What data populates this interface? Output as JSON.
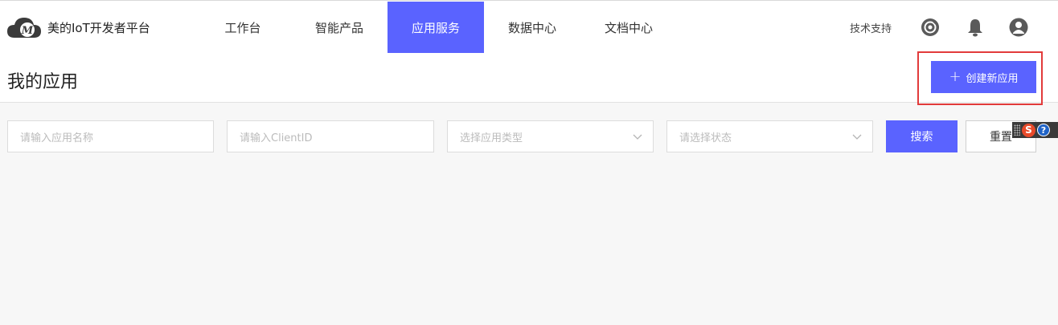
{
  "header": {
    "brand": "美的IoT开发者平台",
    "logo_letter": "M",
    "nav": [
      {
        "label": "工作台",
        "active": false
      },
      {
        "label": "智能产品",
        "active": false
      },
      {
        "label": "应用服务",
        "active": true
      },
      {
        "label": "数据中心",
        "active": false
      },
      {
        "label": "文档中心",
        "active": false
      }
    ],
    "tech_support": "技术支持",
    "icons": [
      "target-icon",
      "bell-icon",
      "user-avatar-icon"
    ]
  },
  "page": {
    "title": "我的应用",
    "create_button": "创建新应用"
  },
  "filters": {
    "app_name_placeholder": "请输入应用名称",
    "client_id_placeholder": "请输入ClientID",
    "app_type_placeholder": "选择应用类型",
    "status_placeholder": "请选择状态",
    "search_button": "搜索",
    "reset_button": "重置"
  },
  "ime_toolbar": {
    "logo_letter": "S",
    "help_symbol": "?"
  },
  "colors": {
    "accent": "#5a63ff",
    "highlight_border": "#e23b3b",
    "page_background": "#f7f7f7"
  }
}
